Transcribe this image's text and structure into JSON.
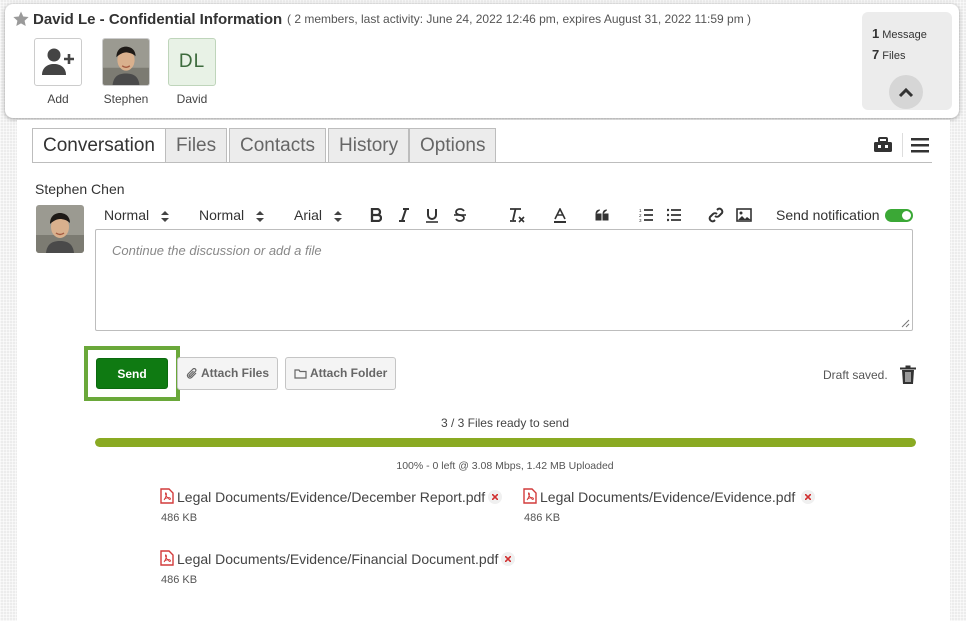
{
  "header": {
    "title": "David Le - Confidential Information",
    "meta": "( 2 members, last activity: June 24, 2022 12:46 pm, expires August 31, 2022 11:59 pm )",
    "members": [
      {
        "label": "Add",
        "icon": "add-user-icon"
      },
      {
        "label": "Stephen",
        "icon": "avatar-photo"
      },
      {
        "label": "David",
        "initials": "DL"
      }
    ],
    "summary": {
      "messages_count": "1",
      "messages_label": "Message",
      "files_count": "7",
      "files_label": "Files"
    }
  },
  "tabs": [
    {
      "label": "Conversation",
      "active": true
    },
    {
      "label": "Files",
      "active": false
    },
    {
      "label": "Contacts",
      "active": false
    },
    {
      "label": "History",
      "active": false
    },
    {
      "label": "Options",
      "active": false
    }
  ],
  "composer": {
    "author": "Stephen Chen",
    "toolbar": {
      "block_style": "Normal",
      "font_size": "Normal",
      "font_family": "Arial"
    },
    "notification_label": "Send notification",
    "notification_on": true,
    "placeholder": "Continue the discussion or add a file",
    "send_label": "Send",
    "attach_files_label": "Attach Files",
    "attach_folder_label": "Attach Folder",
    "draft_status": "Draft saved."
  },
  "upload": {
    "status": "3 / 3 Files ready to send",
    "progress": 1.0,
    "rate": "100% - 0 left @ 3.08 Mbps, 1.42 MB Uploaded",
    "files": [
      {
        "name": "Legal Documents/Evidence/December Report.pdf",
        "size": "486 KB"
      },
      {
        "name": "Legal Documents/Evidence/Evidence.pdf",
        "size": "486 KB"
      },
      {
        "name": "Legal Documents/Evidence/Financial Document.pdf",
        "size": "486 KB"
      }
    ]
  },
  "colors": {
    "accent_green": "#0f7a12",
    "progress": "#8aaa22",
    "toggle": "#3ba836",
    "highlight": "#6aa83a"
  }
}
